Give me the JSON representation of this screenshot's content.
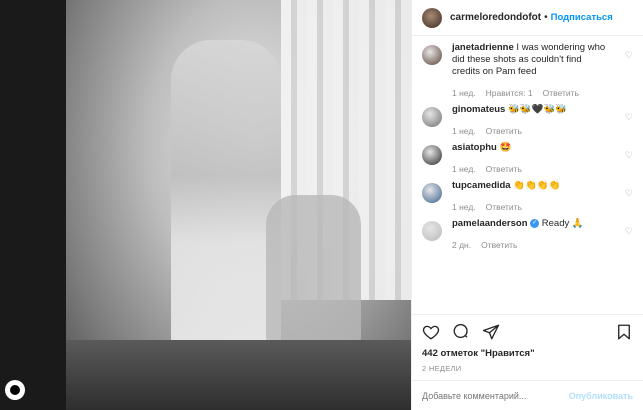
{
  "header": {
    "username": "carmeloredondofot",
    "follow_label": "Подписаться"
  },
  "comments": [
    {
      "user": "janetadrienne",
      "text": "I was wondering who did these shots as couldn't find credits on Pam feed",
      "age": "1 нед.",
      "likes": "Нравится: 1",
      "reply": "Ответить",
      "avatar_color": "#5a3f36"
    },
    {
      "user": "ginomateus",
      "text": "🐝🐝🖤🐝🐝",
      "age": "1 нед.",
      "likes": "",
      "reply": "Ответить",
      "avatar_color": "#6f6f6f"
    },
    {
      "user": "asiatophu",
      "text": "🤩",
      "age": "1 нед.",
      "likes": "",
      "reply": "Ответить",
      "avatar_color": "#2a2a2a"
    },
    {
      "user": "tupcamedida",
      "text": "👏👏👏👏",
      "age": "1 нед.",
      "likes": "",
      "reply": "Ответить",
      "avatar_color": "#3b5f8f"
    },
    {
      "user": "pamelaanderson",
      "text": "Ready 🙏",
      "age": "2 дн.",
      "likes": "",
      "reply": "Ответить",
      "avatar_color": "#b9b9b9",
      "verified": true
    }
  ],
  "likes_text": "442 отметок \"Нравится\"",
  "time_ago": "2 НЕДЕЛИ",
  "add_comment": {
    "placeholder": "Добавьте комментарий...",
    "post_label": "Опубликовать"
  }
}
